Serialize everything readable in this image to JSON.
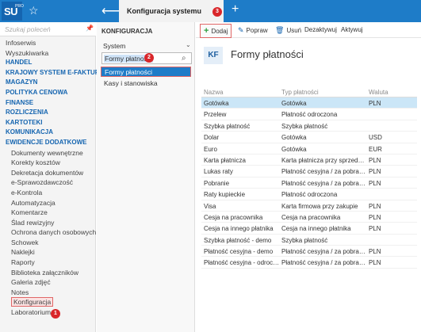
{
  "topbar": {
    "logo_text": "SU",
    "logo_sub": "PRO",
    "tab_title": "Konfiguracja systemu"
  },
  "sidebar": {
    "search_placeholder": "Szukaj poleceń",
    "items": [
      {
        "label": "Infoserwis",
        "type": "item"
      },
      {
        "label": "Wyszukiwarka",
        "type": "item"
      },
      {
        "label": "HANDEL",
        "type": "section"
      },
      {
        "label": "KRAJOWY SYSTEM E-FAKTUR",
        "type": "section"
      },
      {
        "label": "MAGAZYN",
        "type": "section"
      },
      {
        "label": "POLITYKA CENOWA",
        "type": "section"
      },
      {
        "label": "FINANSE",
        "type": "section"
      },
      {
        "label": "ROZLICZENIA",
        "type": "section"
      },
      {
        "label": "KARTOTEKI",
        "type": "section"
      },
      {
        "label": "KOMUNIKACJA",
        "type": "section"
      },
      {
        "label": "EWIDENCJE DODATKOWE",
        "type": "section"
      },
      {
        "label": "Dokumenty wewnętrzne",
        "type": "sub"
      },
      {
        "label": "Korekty kosztów",
        "type": "sub"
      },
      {
        "label": "Dekretacja dokumentów",
        "type": "sub"
      },
      {
        "label": "e-Sprawozdawczość",
        "type": "sub"
      },
      {
        "label": "e-Kontrola",
        "type": "sub"
      },
      {
        "label": "Automatyzacja",
        "type": "sub"
      },
      {
        "label": "Komentarze",
        "type": "sub"
      },
      {
        "label": "Ślad rewizyjny",
        "type": "sub"
      },
      {
        "label": "Ochrona danych osobowych",
        "type": "sub"
      },
      {
        "label": "Schowek",
        "type": "sub"
      },
      {
        "label": "Naklejki",
        "type": "sub"
      },
      {
        "label": "Raporty",
        "type": "sub"
      },
      {
        "label": "Biblioteka załączników",
        "type": "sub"
      },
      {
        "label": "Galeria zdjęć",
        "type": "sub"
      },
      {
        "label": "Notes",
        "type": "sub"
      },
      {
        "label": "Konfiguracja",
        "type": "sub-hl"
      },
      {
        "label": "Laboratorium",
        "type": "sub"
      }
    ]
  },
  "konfig": {
    "title": "KONFIGURACJA",
    "dropdown_value": "System",
    "search_value": "Formy płatności",
    "selected_item": "Formy płatności",
    "other_item": "Kasy i stanowiska"
  },
  "toolbar": {
    "add_label": "Dodaj",
    "edit_label": "Popraw",
    "delete_label": "Usuń",
    "deactivate_label": "Dezaktywuj",
    "activate_label": "Aktywuj"
  },
  "page": {
    "badge": "KF",
    "title": "Formy płatności"
  },
  "table": {
    "headers": [
      "Nazwa",
      "Typ płatności",
      "Waluta"
    ],
    "rows": [
      [
        "Gotówka",
        "Gotówka",
        "PLN"
      ],
      [
        "Przelew",
        "Płatność odroczona",
        ""
      ],
      [
        "Szybka płatność",
        "Szybka płatność",
        ""
      ],
      [
        "Dolar",
        "Gotówka",
        "USD"
      ],
      [
        "Euro",
        "Gotówka",
        "EUR"
      ],
      [
        "Karta płatnicza",
        "Karta płatnicza przy sprzedaż...",
        "PLN"
      ],
      [
        "Lukas raty",
        "Płatność cesyjna / za pobrani...",
        "PLN"
      ],
      [
        "Pobranie",
        "Płatność cesyjna / za pobrani...",
        "PLN"
      ],
      [
        "Raty kupieckie",
        "Płatność odroczona",
        ""
      ],
      [
        "Visa",
        "Karta firmowa przy zakupie",
        "PLN"
      ],
      [
        "Cesja na pracownika",
        "Cesja na pracownika",
        "PLN"
      ],
      [
        "Cesja na innego płatnika",
        "Cesja na innego płatnika",
        "PLN"
      ],
      [
        "Szybka płatność - demo",
        "Szybka płatność",
        ""
      ],
      [
        "Płatność cesyjna - demo",
        "Płatność cesyjna / za pobrani...",
        "PLN"
      ],
      [
        "Płatność cesyjna - odroczo...",
        "Płatność cesyjna / za pobrani...",
        "PLN"
      ]
    ]
  },
  "annotations": [
    "1",
    "2",
    "3"
  ],
  "colors": {
    "accent": "#1e7cc8",
    "highlight_border": "#e06666",
    "badge": "#d9262a",
    "selected_row": "#cbe6f7"
  }
}
